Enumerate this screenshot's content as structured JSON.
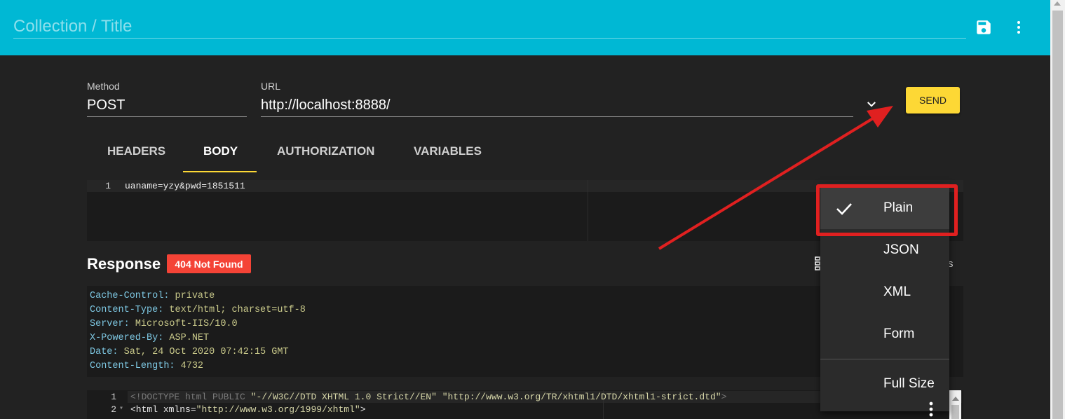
{
  "header": {
    "title_placeholder": "Collection / Title"
  },
  "request": {
    "method_label": "Method",
    "method_value": "POST",
    "url_label": "URL",
    "url_value": "http://localhost:8888/",
    "send_label": "SEND"
  },
  "tabs": [
    {
      "label": "HEADERS"
    },
    {
      "label": "BODY"
    },
    {
      "label": "AUTHORIZATION"
    },
    {
      "label": "VARIABLES"
    }
  ],
  "body_editor": {
    "lines": [
      {
        "num": "1",
        "text": "uaname=yzy&pwd=1851511"
      }
    ]
  },
  "response": {
    "title": "Response",
    "status": "404 Not Found",
    "trailing_text": "s",
    "headers": [
      {
        "key": "Cache-Control",
        "value": "private"
      },
      {
        "key": "Content-Type",
        "value": "text/html; charset=utf-8"
      },
      {
        "key": "Server",
        "value": "Microsoft-IIS/10.0"
      },
      {
        "key": "X-Powered-By",
        "value": "ASP.NET"
      },
      {
        "key": "Date",
        "value": "Sat, 24 Oct 2020 07:42:15 GMT"
      },
      {
        "key": "Content-Length",
        "value": "4732"
      }
    ],
    "code_lines": [
      {
        "num": "1",
        "p1": "<!DOCTYPE html PUBLIC ",
        "s1": "\"-//W3C//DTD XHTML 1.0 Strict//EN\"",
        "sp": " ",
        "s2": "\"http://www.w3.org/TR/xhtml1/DTD/xhtml1-strict.dtd\"",
        "p2": ">"
      },
      {
        "num": "2",
        "fold": "▾",
        "tag": "<html",
        "attr": " xmlns",
        "eq": "=",
        "val": "\"http://www.w3.org/1999/xhtml\"",
        "close": ">"
      }
    ]
  },
  "dropdown_menu": {
    "items": [
      {
        "label": "Plain",
        "selected": true
      },
      {
        "label": "JSON"
      },
      {
        "label": "XML"
      },
      {
        "label": "Form"
      },
      {
        "label": "Full Size"
      }
    ]
  },
  "colors": {
    "topbar": "#00b8d4",
    "accent": "#fdd835",
    "error": "#f44336",
    "annotation": "#e02020"
  },
  "icons": [
    "save-icon",
    "more-vert-icon",
    "chevron-down-icon",
    "check-icon"
  ]
}
